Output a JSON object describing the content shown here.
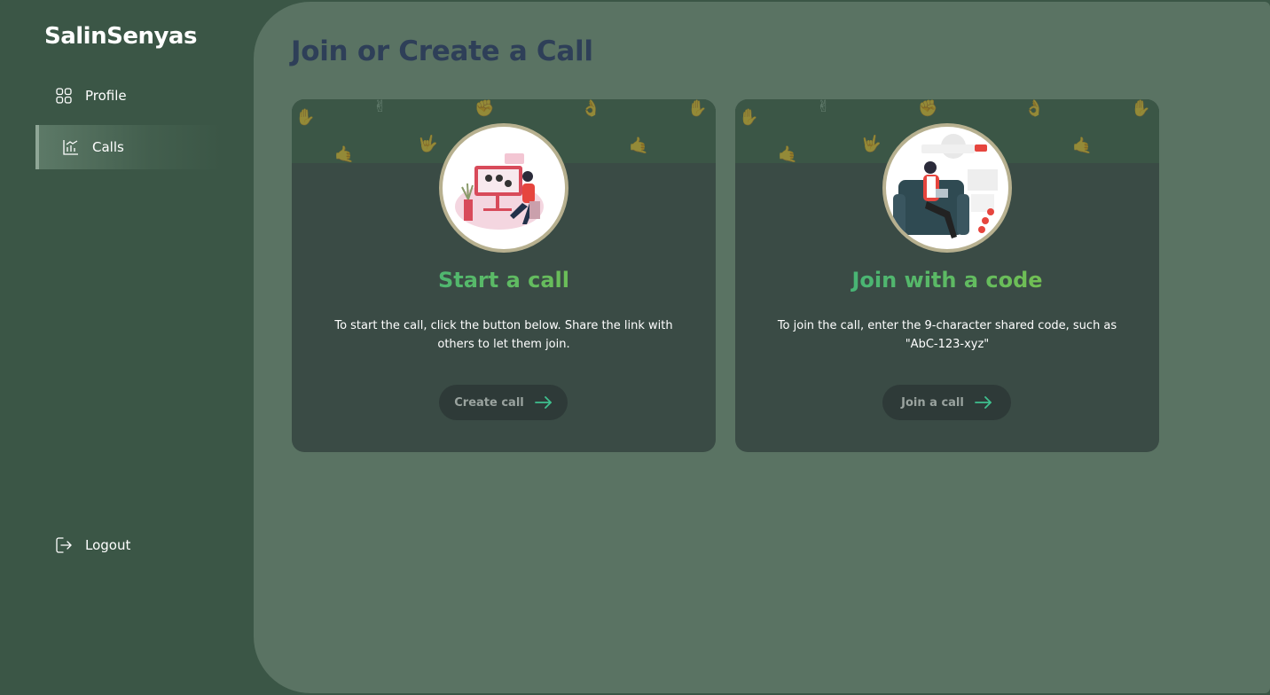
{
  "app": {
    "brand": "SalinSenyas"
  },
  "sidebar": {
    "items": [
      {
        "label": "Profile",
        "icon": "grid-icon"
      },
      {
        "label": "Calls",
        "icon": "chart-icon",
        "active": true
      }
    ],
    "logout": {
      "label": "Logout",
      "icon": "logout-icon"
    }
  },
  "main": {
    "title": "Join or Create a Call",
    "cards": [
      {
        "heading": "Start a call",
        "description": "To start the call, click the button below. Share the link with others to let them join.",
        "button_label": "Create call",
        "illustration": "person-at-computer-illustration"
      },
      {
        "heading": "Join with a code",
        "description": "To join the call, enter the 9-character shared code, such as \"AbC-123-xyz\"",
        "button_label": "Join a call",
        "illustration": "person-on-sofa-illustration"
      }
    ]
  },
  "colors": {
    "sidebar_bg": "#3b5646",
    "main_bg": "#5a7363",
    "card_bg": "#3a4b45",
    "title": "#2e3f58",
    "heading_gradient_start": "#2eae8a",
    "heading_gradient_end": "#8cc63e",
    "button_bg": "#2e3a38",
    "arrow": "#3fc08e"
  }
}
